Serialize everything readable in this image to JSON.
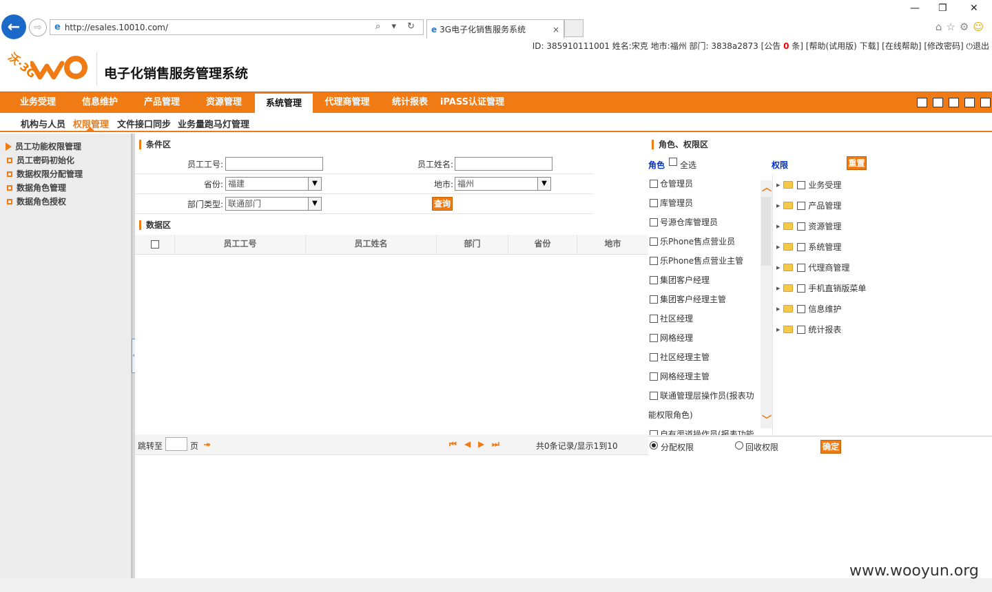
{
  "browser": {
    "url": "http://esales.10010.com/",
    "tab_title": "3G电子化销售服务系统",
    "tab_close": "×",
    "ie_glyph": "e",
    "addr_tools": "⌕ ▾ ↻",
    "back": "←",
    "forward": "⇨",
    "win_min": "—",
    "win_restore": "❐",
    "win_close": "✕",
    "icons": [
      "home-icon",
      "star-icon",
      "gear-icon",
      "smiley-icon"
    ],
    "home": "⌂",
    "star": "☆",
    "gear": "⚙",
    "smile": "☺"
  },
  "infobar": {
    "prefix": "ID: 385910111001 姓名:宋克 地市:福州 部门: 3838a2873 [公告 ",
    "count": "0",
    "suffix": " 条] [帮助(试用版) 下载] [在线帮助] [修改密码] ⏻退出"
  },
  "header": {
    "logo_3g": "沃·3G",
    "system_name": "电子化销售服务管理系统",
    "brand_color": "#f07a14"
  },
  "main_nav": [
    "业务受理",
    "信息维护",
    "产品管理",
    "资源管理",
    "系统管理",
    "代理商管理",
    "统计报表",
    "iPASS认证管理"
  ],
  "main_nav_active": "系统管理",
  "sub_nav": [
    "机构与人员",
    "权限管理",
    "文件接口同步",
    "业务量跑马灯管理"
  ],
  "sub_nav_active": "权限管理",
  "left_menu": [
    "员工功能权限管理",
    "员工密码初始化",
    "数据权限分配管理",
    "数据角色管理",
    "数据角色授权"
  ],
  "condition": {
    "title": "条件区",
    "emp_id_label": "员工工号:",
    "emp_name_label": "员工姓名:",
    "province_label": "省份:",
    "province_value": "福建",
    "city_label": "地市:",
    "city_value": "福州",
    "dept_type_label": "部门类型:",
    "dept_type_value": "联通部门",
    "query_button": "查询",
    "dropdown_glyph": "▼"
  },
  "data_area": {
    "title": "数据区",
    "columns": [
      "员工工号",
      "员工姓名",
      "部门",
      "省份",
      "地市"
    ],
    "rows": []
  },
  "pager": {
    "goto_label": "跳转至",
    "page_label": "页",
    "go_icon": "⯮",
    "first": "⏮",
    "prev": "◀",
    "next": "▶",
    "last": "⏭",
    "summary": "共0条记录/显示1到10"
  },
  "role_area": {
    "title": "角色、权限区",
    "role_label": "角色",
    "select_all": "全选",
    "perm_label": "权限",
    "reset_button": "重置",
    "roles": [
      "仓管理员",
      "库管理员",
      "号源仓库管理员",
      "乐Phone售点营业员",
      "乐Phone售点营业主管",
      "集团客户经理",
      "集团客户经理主管",
      "社区经理",
      "网格经理",
      "社区经理主管",
      "网格经理主管",
      "联通管理层操作员(报表功",
      "能权限角色)",
      "自有渠道操作员(报表功能"
    ],
    "permissions": [
      "业务受理",
      "产品管理",
      "资源管理",
      "系统管理",
      "代理商管理",
      "手机直销版菜单",
      "信息维护",
      "统计报表"
    ],
    "assign_label": "分配权限",
    "revoke_label": "回收权限",
    "confirm_button": "确定",
    "scroll_up": "︿",
    "scroll_down": "﹀",
    "expander": "▶"
  },
  "watermark": "www.wooyun.org"
}
